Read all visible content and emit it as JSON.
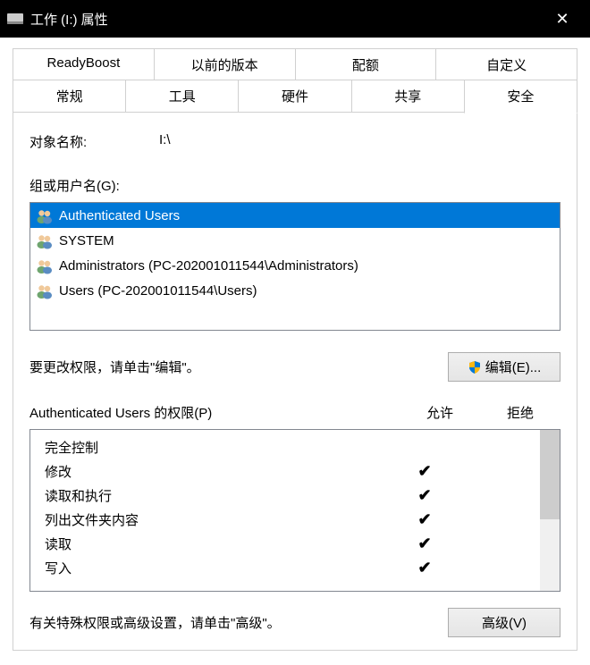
{
  "titlebar": {
    "title": "工作 (I:) 属性"
  },
  "tabs": {
    "row1": [
      {
        "label": "ReadyBoost"
      },
      {
        "label": "以前的版本"
      },
      {
        "label": "配额"
      },
      {
        "label": "自定义"
      }
    ],
    "row2": [
      {
        "label": "常规"
      },
      {
        "label": "工具"
      },
      {
        "label": "硬件"
      },
      {
        "label": "共享"
      },
      {
        "label": "安全",
        "active": true
      }
    ]
  },
  "object": {
    "label": "对象名称:",
    "value": "I:\\"
  },
  "groups": {
    "label": "组或用户名(G):",
    "items": [
      {
        "name": "Authenticated Users",
        "selected": true
      },
      {
        "name": "SYSTEM"
      },
      {
        "name": "Administrators (PC-202001011544\\Administrators)"
      },
      {
        "name": "Users (PC-202001011544\\Users)"
      }
    ]
  },
  "edit": {
    "text": "要更改权限，请单击\"编辑\"。",
    "button": "编辑(E)..."
  },
  "permissions": {
    "title": "Authenticated Users 的权限(P)",
    "allow": "允许",
    "deny": "拒绝",
    "items": [
      {
        "name": "完全控制",
        "allow": false,
        "deny": false
      },
      {
        "name": "修改",
        "allow": true,
        "deny": false
      },
      {
        "name": "读取和执行",
        "allow": true,
        "deny": false
      },
      {
        "name": "列出文件夹内容",
        "allow": true,
        "deny": false
      },
      {
        "name": "读取",
        "allow": true,
        "deny": false
      },
      {
        "name": "写入",
        "allow": true,
        "deny": false
      }
    ]
  },
  "advanced": {
    "text": "有关特殊权限或高级设置，请单击\"高级\"。",
    "button": "高级(V)"
  }
}
